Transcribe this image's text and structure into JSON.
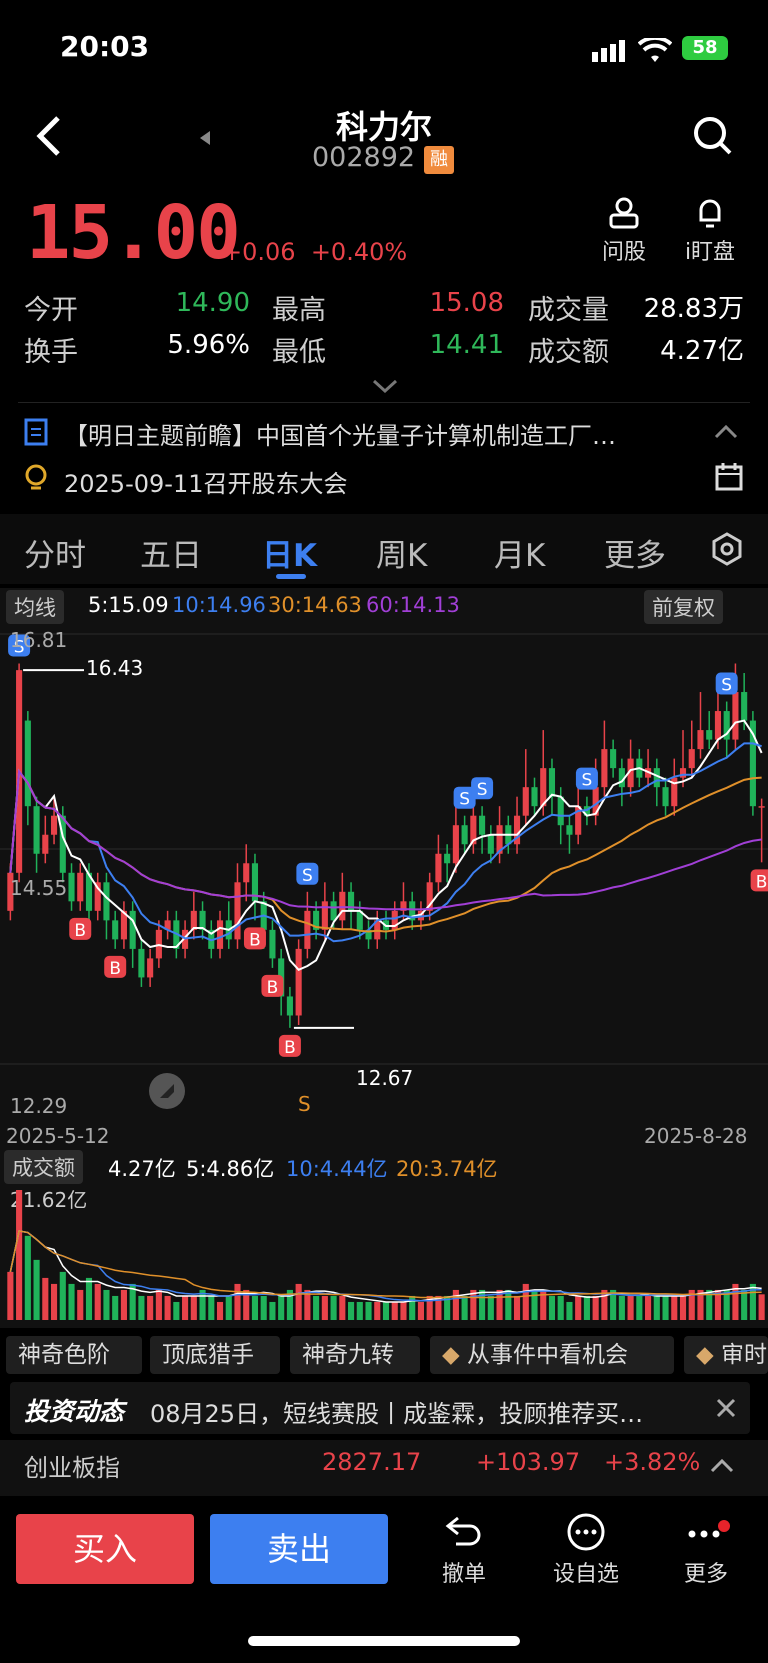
{
  "status": {
    "time": "20:03",
    "battery": "58"
  },
  "header": {
    "name": "科力尔",
    "code": "002892",
    "badge": "融"
  },
  "quote": {
    "price": "15.00",
    "change": "+0.06",
    "change_pct": "+0.40%",
    "actions": [
      {
        "label": "问股",
        "icon": "person-icon"
      },
      {
        "label": "i盯盘",
        "icon": "bell-icon"
      }
    ]
  },
  "stats": [
    {
      "label": "今开",
      "value": "14.90",
      "color": "#2fb85a"
    },
    {
      "label": "最高",
      "value": "15.08",
      "color": "#e8434a"
    },
    {
      "label": "成交量",
      "value": "28.83万",
      "color": "#ffffff"
    },
    {
      "label": "换手",
      "value": "5.96%",
      "color": "#ffffff"
    },
    {
      "label": "最低",
      "value": "14.41",
      "color": "#2fb85a"
    },
    {
      "label": "成交额",
      "value": "4.27亿",
      "color": "#ffffff"
    }
  ],
  "notices": [
    "【明日主题前瞻】中国首个光量子计算机制造工厂…",
    "2025-09-11召开股东大会"
  ],
  "tabs": [
    "分时",
    "五日",
    "日K",
    "周K",
    "月K",
    "更多"
  ],
  "active_tab": "日K",
  "chart": {
    "ma_pill": "均线",
    "ma5": "5:15.09",
    "ma10": "10:14.96",
    "ma30": "30:14.63",
    "ma60": "60:14.13",
    "adjust": "前复权",
    "y_top": "16.81",
    "y_mid": "14.55",
    "y_bottom": "12.29",
    "high_annot": "16.43",
    "low_annot": "12.67",
    "s_marker": "S",
    "date_start": "2025-5-12",
    "date_end": "2025-8-28",
    "vol_pill": "成交额",
    "vol_val": "4.27亿",
    "vol_ma5": "5:4.86亿",
    "vol_ma10": "10:4.44亿",
    "vol_ma20": "20:3.74亿",
    "vol_top": "21.62亿",
    "colors": {
      "up": "#e8434a",
      "down": "#20b25a",
      "ma5": "#ffffff",
      "ma10": "#3d7ff0",
      "ma30": "#e0902a",
      "ma60": "#a13fd6"
    }
  },
  "chart_data": {
    "type": "candlestick",
    "x_range": [
      "2025-5-12",
      "2025-8-28"
    ],
    "ylim": [
      12.29,
      16.81
    ],
    "markers": {
      "buy": [
        "B",
        "B",
        "B",
        "B",
        "B",
        "B",
        "B"
      ],
      "sell": [
        "S",
        "S",
        "S",
        "S",
        "S",
        "S"
      ]
    },
    "candles": [
      [
        13.9,
        14.3,
        14.4,
        13.8
      ],
      [
        14.3,
        16.43,
        16.5,
        14.2
      ],
      [
        15.9,
        15.0,
        16.0,
        14.8
      ],
      [
        15.0,
        14.5,
        15.1,
        14.3
      ],
      [
        14.5,
        14.7,
        14.9,
        14.4
      ],
      [
        14.7,
        14.9,
        15.1,
        14.6
      ],
      [
        14.9,
        14.3,
        15.0,
        14.2
      ],
      [
        14.3,
        14.0,
        14.4,
        13.9
      ],
      [
        14.0,
        14.3,
        14.4,
        13.9
      ],
      [
        14.3,
        13.9,
        14.4,
        13.7
      ],
      [
        13.9,
        14.2,
        14.3,
        13.8
      ],
      [
        14.2,
        13.8,
        14.3,
        13.6
      ],
      [
        13.8,
        13.6,
        13.9,
        13.5
      ],
      [
        13.6,
        13.9,
        14.0,
        13.5
      ],
      [
        13.9,
        13.5,
        14.0,
        13.3
      ],
      [
        13.5,
        13.2,
        13.6,
        13.1
      ],
      [
        13.2,
        13.4,
        13.5,
        13.1
      ],
      [
        13.4,
        13.7,
        13.8,
        13.3
      ],
      [
        13.7,
        13.8,
        13.9,
        13.6
      ],
      [
        13.8,
        13.5,
        13.9,
        13.4
      ],
      [
        13.5,
        13.7,
        13.8,
        13.4
      ],
      [
        13.7,
        13.9,
        14.1,
        13.6
      ],
      [
        13.9,
        13.7,
        14.0,
        13.6
      ],
      [
        13.7,
        13.5,
        13.8,
        13.4
      ],
      [
        13.5,
        13.8,
        13.9,
        13.4
      ],
      [
        13.8,
        13.6,
        14.0,
        13.5
      ],
      [
        13.6,
        14.2,
        14.4,
        13.5
      ],
      [
        14.2,
        14.4,
        14.6,
        14.0
      ],
      [
        14.4,
        14.0,
        14.5,
        13.8
      ],
      [
        14.0,
        13.7,
        14.1,
        13.5
      ],
      [
        13.7,
        13.4,
        13.8,
        13.3
      ],
      [
        13.4,
        13.0,
        13.5,
        12.8
      ],
      [
        13.0,
        12.8,
        13.1,
        12.67
      ],
      [
        12.8,
        13.5,
        13.6,
        12.7
      ],
      [
        13.5,
        13.9,
        14.1,
        13.4
      ],
      [
        13.9,
        13.7,
        14.0,
        13.6
      ],
      [
        13.7,
        14.0,
        14.2,
        13.6
      ],
      [
        14.0,
        13.8,
        14.1,
        13.7
      ],
      [
        13.8,
        14.1,
        14.3,
        13.7
      ],
      [
        14.1,
        13.9,
        14.2,
        13.7
      ],
      [
        13.9,
        13.7,
        14.0,
        13.6
      ],
      [
        13.7,
        13.6,
        13.8,
        13.5
      ],
      [
        13.6,
        13.8,
        13.9,
        13.5
      ],
      [
        13.8,
        13.7,
        13.9,
        13.6
      ],
      [
        13.7,
        13.9,
        14.0,
        13.6
      ],
      [
        13.9,
        14.0,
        14.2,
        13.8
      ],
      [
        14.0,
        13.8,
        14.1,
        13.7
      ],
      [
        13.8,
        13.9,
        14.0,
        13.7
      ],
      [
        13.9,
        14.2,
        14.3,
        13.8
      ],
      [
        14.2,
        14.5,
        14.7,
        14.1
      ],
      [
        14.5,
        14.4,
        14.6,
        14.2
      ],
      [
        14.4,
        14.8,
        15.0,
        14.3
      ],
      [
        14.8,
        14.6,
        14.9,
        14.5
      ],
      [
        14.6,
        14.9,
        15.2,
        14.5
      ],
      [
        14.9,
        14.7,
        15.0,
        14.5
      ],
      [
        14.7,
        14.5,
        14.8,
        14.4
      ],
      [
        14.5,
        14.8,
        15.0,
        14.4
      ],
      [
        14.8,
        14.6,
        14.9,
        14.5
      ],
      [
        14.6,
        14.9,
        15.1,
        14.5
      ],
      [
        14.9,
        15.2,
        15.6,
        14.8
      ],
      [
        15.2,
        15.0,
        15.3,
        14.9
      ],
      [
        15.0,
        15.4,
        15.8,
        14.9
      ],
      [
        15.4,
        15.1,
        15.5,
        14.9
      ],
      [
        15.1,
        14.8,
        15.2,
        14.6
      ],
      [
        14.8,
        14.7,
        14.9,
        14.5
      ],
      [
        14.7,
        15.0,
        15.2,
        14.6
      ],
      [
        15.0,
        14.9,
        15.1,
        14.8
      ],
      [
        14.9,
        15.2,
        15.5,
        14.8
      ],
      [
        15.2,
        15.6,
        15.9,
        15.1
      ],
      [
        15.6,
        15.4,
        15.7,
        15.3
      ],
      [
        15.4,
        15.2,
        15.5,
        15.0
      ],
      [
        15.2,
        15.5,
        15.7,
        15.1
      ],
      [
        15.5,
        15.3,
        15.6,
        15.2
      ],
      [
        15.3,
        15.4,
        15.6,
        15.2
      ],
      [
        15.4,
        15.2,
        15.5,
        15.0
      ],
      [
        15.2,
        15.0,
        15.3,
        14.9
      ],
      [
        15.0,
        15.3,
        15.5,
        14.9
      ],
      [
        15.3,
        15.4,
        15.8,
        15.2
      ],
      [
        15.4,
        15.6,
        15.9,
        15.3
      ],
      [
        15.6,
        15.8,
        16.2,
        15.5
      ],
      [
        15.8,
        15.7,
        16.0,
        15.6
      ],
      [
        15.7,
        16.0,
        16.2,
        15.6
      ],
      [
        16.0,
        15.7,
        16.1,
        15.5
      ],
      [
        15.7,
        16.2,
        16.5,
        15.6
      ],
      [
        16.2,
        15.9,
        16.4,
        15.8
      ],
      [
        15.9,
        15.0,
        16.0,
        14.9
      ],
      [
        15.0,
        15.0,
        15.08,
        14.41
      ]
    ],
    "volume": [
      8,
      21.62,
      14,
      10,
      7,
      6,
      8,
      6,
      5,
      7,
      6,
      5,
      4,
      5,
      6,
      4,
      4,
      5,
      4,
      3,
      4,
      4,
      5,
      4,
      3,
      4,
      6,
      5,
      4,
      4,
      3,
      4,
      5,
      6,
      5,
      4,
      4,
      4,
      4,
      3,
      3,
      3,
      3,
      3,
      3,
      3,
      4,
      3,
      4,
      4,
      4,
      5,
      4,
      5,
      5,
      4,
      5,
      5,
      4,
      6,
      5,
      5,
      4,
      4,
      3,
      4,
      4,
      4,
      5,
      5,
      4,
      4,
      4,
      4,
      4,
      4,
      4,
      4,
      5,
      5,
      5,
      5,
      5,
      6,
      5,
      6,
      4.27
    ]
  },
  "tools": [
    "神奇色阶",
    "顶底猎手",
    "神奇九转",
    "从事件中看机会",
    "审时"
  ],
  "news": {
    "brand": "投资动态",
    "text": "08月25日，短线赛股丨成鉴霖，投顾推荐买…"
  },
  "index": {
    "name": "创业板指",
    "value": "2827.17",
    "change": "+103.97",
    "change_pct": "+3.82%"
  },
  "bottom": {
    "buy": "买入",
    "sell": "卖出",
    "cancel": "撤单",
    "watch": "设自选",
    "more": "更多"
  }
}
